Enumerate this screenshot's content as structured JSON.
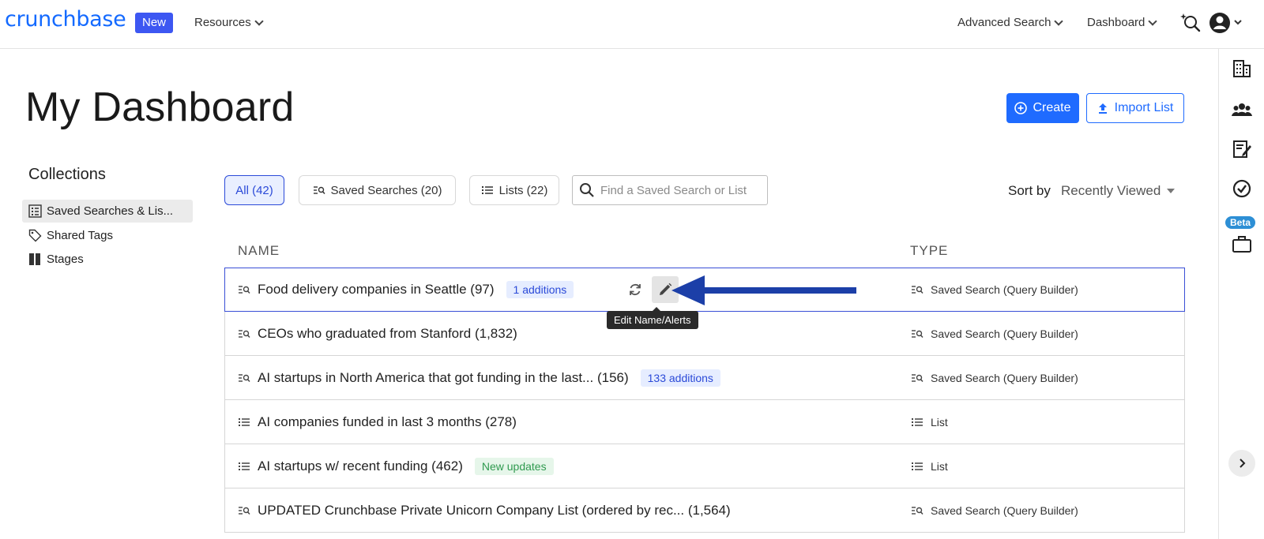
{
  "topbar": {
    "logo": "crunchbase",
    "new_badge": "New",
    "resources": "Resources",
    "advanced_search": "Advanced Search",
    "dashboard": "Dashboard"
  },
  "rail": {
    "beta": "Beta"
  },
  "header": {
    "title": "My Dashboard",
    "create": "Create",
    "import_list": "Import List"
  },
  "collections": {
    "title": "Collections",
    "items": [
      {
        "label": "Saved Searches & Lis...",
        "active": true
      },
      {
        "label": "Shared Tags",
        "active": false
      },
      {
        "label": "Stages",
        "active": false
      }
    ]
  },
  "filters": {
    "all": "All (42)",
    "saved_searches": "Saved Searches (20)",
    "lists": "Lists (22)",
    "search_placeholder": "Find a Saved Search or List",
    "sort_label": "Sort by",
    "sort_value": "Recently Viewed"
  },
  "table": {
    "col_name": "NAME",
    "col_type": "TYPE",
    "tooltip": "Edit Name/Alerts",
    "rows": [
      {
        "name": "Food delivery companies in Seattle (97)",
        "badge": "1 additions",
        "type": "Saved Search (Query Builder)"
      },
      {
        "name": "CEOs who graduated from Stanford (1,832)",
        "badge": "",
        "type": "Saved Search (Query Builder)"
      },
      {
        "name": "AI startups in North America that got funding in the last... (156)",
        "badge": "133 additions",
        "type": "Saved Search (Query Builder)"
      },
      {
        "name": "AI companies funded in last 3 months (278)",
        "badge": "",
        "type": "List"
      },
      {
        "name": "AI startups w/ recent funding (462)",
        "badge": "New updates",
        "type": "List"
      },
      {
        "name": "UPDATED Crunchbase Private Unicorn Company List (ordered by rec... (1,564)",
        "badge": "",
        "type": "Saved Search (Query Builder)"
      }
    ]
  },
  "colors": {
    "brand": "#146aff",
    "accent": "#1f6bff",
    "badge_blue": "#2b4ad8",
    "badge_green": "#2f9a4f",
    "annotation_arrow": "#1c3fa8"
  }
}
